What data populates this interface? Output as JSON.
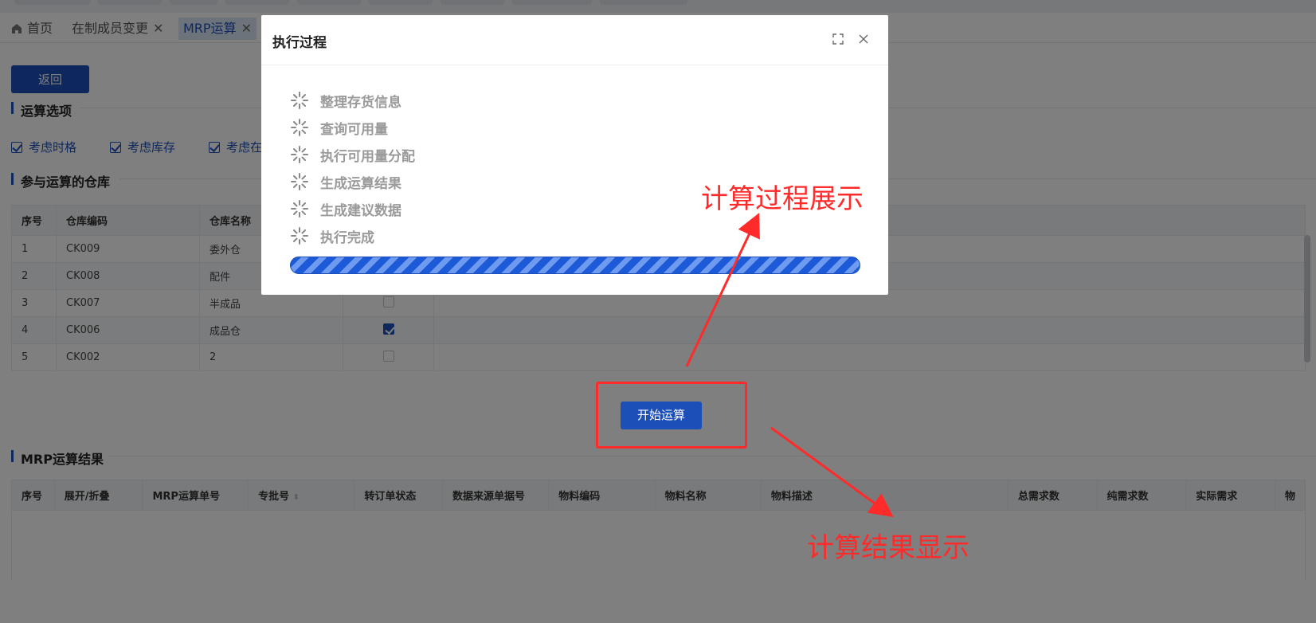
{
  "tabs": {
    "home": "首页",
    "member_change": "在制成员变更",
    "mrp": "MRP运算"
  },
  "page": {
    "back_button": "返回",
    "options_title": "运算选项",
    "options": [
      {
        "label": "考虑时格",
        "checked": true
      },
      {
        "label": "考虑库存",
        "checked": true
      },
      {
        "label": "考虑在",
        "checked": true
      }
    ],
    "warehouse_title": "参与运算的仓库",
    "warehouse_headers": [
      "序号",
      "仓库编码",
      "仓库名称"
    ],
    "warehouses": [
      {
        "no": "1",
        "code": "CK009",
        "name": "委外仓"
      },
      {
        "no": "2",
        "code": "CK008",
        "name": "配件"
      },
      {
        "no": "3",
        "code": "CK007",
        "name": "半成品",
        "selected": false
      },
      {
        "no": "4",
        "code": "CK006",
        "name": "成品仓",
        "selected": true
      },
      {
        "no": "5",
        "code": "CK002",
        "name": "2",
        "selected": false
      }
    ],
    "start_button": "开始运算",
    "result_title": "MRP运算结果",
    "result_headers": [
      "序号",
      "展开/折叠",
      "MRP运算单号",
      "专批号",
      "转订单状态",
      "数据来源单据号",
      "物料编码",
      "物料名称",
      "物料描述",
      "总需求数",
      "纯需求数",
      "实际需求",
      "物"
    ]
  },
  "dialog": {
    "title": "执行过程",
    "steps": [
      "整理存货信息",
      "查询可用量",
      "执行可用量分配",
      "生成运算结果",
      "生成建议数据",
      "执行完成"
    ],
    "progress": 1.0
  },
  "annotations": {
    "process": "计算过程展示",
    "result": "计算结果显示"
  },
  "colors": {
    "primary": "#1d4fb8",
    "annotation": "#ff2a2a"
  }
}
